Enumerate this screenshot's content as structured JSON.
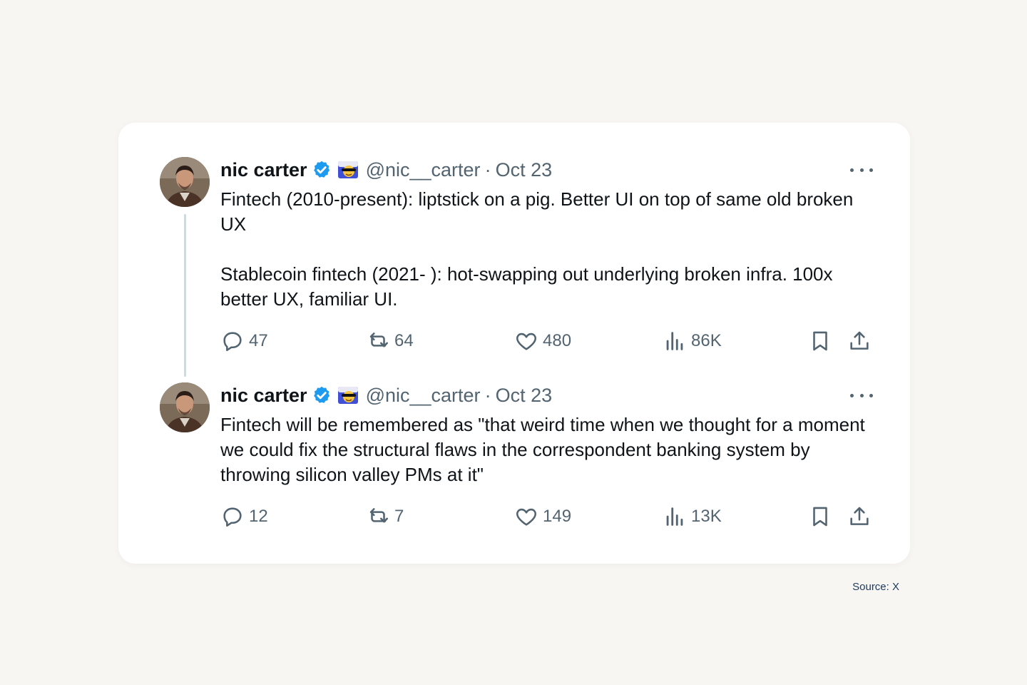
{
  "tweets": [
    {
      "name": "nic carter",
      "handle": "@nic__carter",
      "separator": "·",
      "date": "Oct 23",
      "text": "Fintech (2010-present): liptstick on a pig. Better UI on top of same old broken UX\n\nStablecoin fintech (2021- ): hot-swapping out underlying broken infra. 100x better UX, familiar UI.",
      "replies": "47",
      "retweets": "64",
      "likes": "480",
      "views": "86K"
    },
    {
      "name": "nic carter",
      "handle": "@nic__carter",
      "separator": "·",
      "date": "Oct 23",
      "text": "Fintech will be remembered as \"that weird time when we thought for a moment we could fix the structural flaws in the correspondent banking system by throwing silicon valley PMs at it\"",
      "replies": "12",
      "retweets": "7",
      "likes": "149",
      "views": "13K"
    }
  ],
  "source": "Source: X",
  "colors": {
    "background": "#f8f6f3",
    "card": "#ffffff",
    "verified": "#1d9bf0",
    "muted": "#536471",
    "source": "#1c3a5e"
  },
  "icons": [
    "verified-badge-icon",
    "sunglasses-emoji-icon",
    "more-icon",
    "reply-icon",
    "retweet-icon",
    "like-icon",
    "views-icon",
    "bookmark-icon",
    "share-icon"
  ]
}
